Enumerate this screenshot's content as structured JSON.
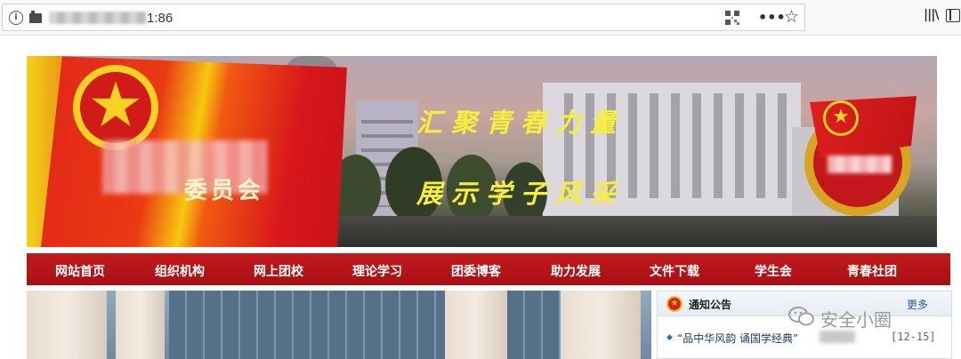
{
  "browser": {
    "url_suffix": "1:86",
    "icons": [
      "info-icon",
      "site-icon",
      "qr-code-icon",
      "more-actions-icon",
      "bookmark-star-icon",
      "library-icon",
      "sidebar-icon"
    ]
  },
  "banner": {
    "flag_text": "委员会",
    "slogan_line1": "汇聚青春力量",
    "slogan_line2": "展示学子风采",
    "colors": {
      "flag_red": "#d8171b",
      "flag_yellow": "#f7c80f",
      "slogan_yellow": "#f7ef3a"
    }
  },
  "nav": {
    "items": [
      {
        "label": "网站首页"
      },
      {
        "label": "组织机构"
      },
      {
        "label": "网上团校"
      },
      {
        "label": "理论学习"
      },
      {
        "label": "团委博客"
      },
      {
        "label": "助力发展"
      },
      {
        "label": "文件下载"
      },
      {
        "label": "学生会"
      },
      {
        "label": "青春社团"
      }
    ],
    "color": "#b8141a"
  },
  "notice": {
    "title": "通知公告",
    "more": "更多",
    "items": [
      {
        "text": "“品中华风韵 诵国学经典”",
        "date": "[12-15]"
      }
    ]
  },
  "watermark": {
    "text": "安全小圈"
  }
}
